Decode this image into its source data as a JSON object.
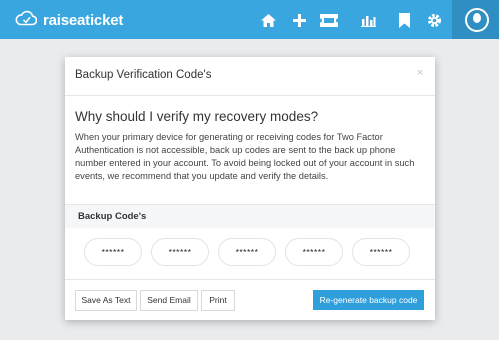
{
  "header": {
    "brand": "raiseaticket",
    "colors": {
      "bar": "#3aa6df",
      "avatar_bg": "#2f8fc3"
    },
    "nav_icons": [
      "home-icon",
      "plus-icon",
      "ticket-icon",
      "bar-chart-icon",
      "bookmark-icon",
      "gear-icon"
    ]
  },
  "modal": {
    "title": "Backup Verification Code's",
    "close_label": "×",
    "question": "Why should I verify my recovery modes?",
    "body": "When your primary device for generating or receiving codes for Two Factor Authentication is not accessible, back up codes are sent to the back up phone number entered in your account. To avoid being locked out of your account in such events, we recommend that you update and verify the details.",
    "codes_label": "Backup Code's",
    "codes": [
      "******",
      "******",
      "******",
      "******",
      "******"
    ],
    "buttons": {
      "save_as_text": "Save As Text",
      "send_email": "Send Email",
      "print": "Print",
      "regenerate": "Re-generate backup code"
    },
    "colors": {
      "primary_button": "#2f9fdc"
    }
  }
}
